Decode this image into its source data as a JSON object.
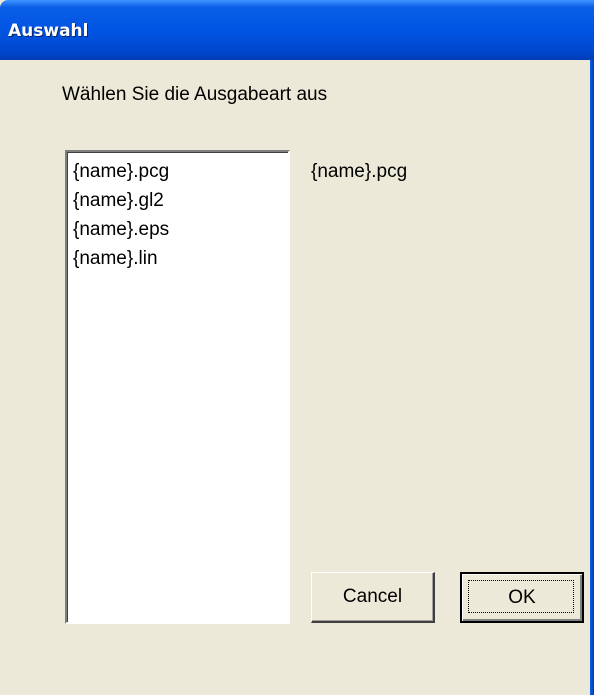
{
  "window": {
    "title": "Auswahl"
  },
  "dialog": {
    "prompt": "Wählen Sie die Ausgabeart aus",
    "list_items": [
      "{name}.pcg",
      "{name}.gl2",
      "{name}.eps",
      "{name}.lin"
    ],
    "selected_value": "{name}.pcg"
  },
  "buttons": {
    "cancel_label": "Cancel",
    "ok_label": "OK"
  },
  "colors": {
    "titlebar": "#0054e3",
    "dialog_background": "#ece9d8",
    "list_background": "#ffffff"
  }
}
